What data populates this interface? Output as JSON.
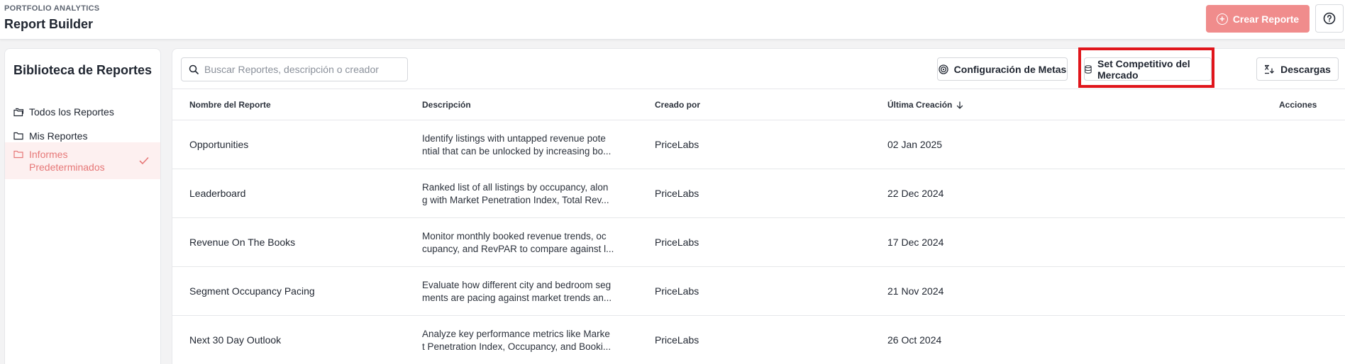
{
  "header": {
    "subtitle": "PORTFOLIO ANALYTICS",
    "title": "Report Builder",
    "create_button": "Crear Reporte"
  },
  "sidebar": {
    "title": "Biblioteca de Reportes",
    "items": [
      {
        "label": "Todos los Reportes",
        "icon": "folders-icon",
        "active": false
      },
      {
        "label": "Mis Reportes",
        "icon": "folder-icon",
        "active": false
      },
      {
        "label_line1": "Informes",
        "label_line2": "Predeterminados",
        "icon": "folder-icon",
        "active": true
      }
    ]
  },
  "toolbar": {
    "search_placeholder": "Buscar Reportes, descripción o creador",
    "goals_button": "Configuración de Metas",
    "market_button": "Set Competitivo del Mercado",
    "downloads_button": "Descargas"
  },
  "table": {
    "columns": {
      "name": "Nombre del Reporte",
      "description": "Descripción",
      "creator": "Creado por",
      "last_created": "Última Creación",
      "actions": "Acciones"
    },
    "rows": [
      {
        "name": "Opportunities",
        "desc1": "Identify listings with untapped revenue pote",
        "desc2": "ntial that can be unlocked by increasing bo...",
        "creator": "PriceLabs",
        "date": "02 Jan 2025"
      },
      {
        "name": "Leaderboard",
        "desc1": "Ranked list of all listings by occupancy, alon",
        "desc2": "g with Market Penetration Index, Total Rev...",
        "creator": "PriceLabs",
        "date": "22 Dec 2024"
      },
      {
        "name": "Revenue On The Books",
        "desc1": "Monitor monthly booked revenue trends, oc",
        "desc2": "cupancy, and RevPAR to compare against l...",
        "creator": "PriceLabs",
        "date": "17 Dec 2024"
      },
      {
        "name": "Segment Occupancy Pacing",
        "desc1": "Evaluate how different city and bedroom seg",
        "desc2": "ments are pacing against market trends an...",
        "creator": "PriceLabs",
        "date": "21 Nov 2024"
      },
      {
        "name": "Next 30 Day Outlook",
        "desc1": "Analyze key performance metrics like Marke",
        "desc2": "t Penetration Index, Occupancy, and Booki...",
        "creator": "PriceLabs",
        "date": "26 Oct 2024"
      }
    ]
  },
  "colors": {
    "accent": "#f08c8c",
    "active_text": "#e67777",
    "highlight": "#e0151b"
  }
}
